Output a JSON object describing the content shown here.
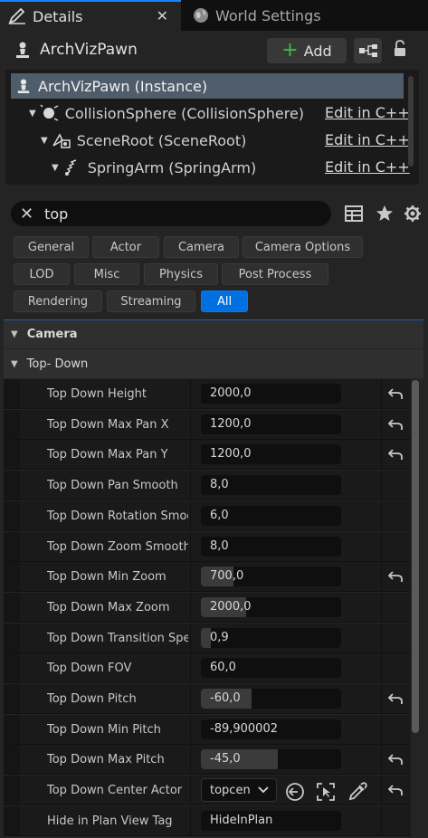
{
  "tabs": [
    {
      "label": "Details",
      "active": true
    },
    {
      "label": "World Settings",
      "active": false
    }
  ],
  "header": {
    "title": "ArchVizPawn",
    "add_label": "Add"
  },
  "tree": [
    {
      "label": "ArchVizPawn (Instance)",
      "edit": ""
    },
    {
      "label": "CollisionSphere (CollisionSphere)",
      "edit": "Edit in C++"
    },
    {
      "label": "SceneRoot (SceneRoot)",
      "edit": "Edit in C++"
    },
    {
      "label": "SpringArm (SpringArm)",
      "edit": "Edit in C++"
    }
  ],
  "search": {
    "value": "top"
  },
  "filters": [
    "General",
    "Actor",
    "Camera",
    "Camera Options",
    "LOD",
    "Misc",
    "Physics",
    "Post Process",
    "Rendering",
    "Streaming",
    "All"
  ],
  "active_filter": "All",
  "categories": [
    "Camera",
    "Top- Down"
  ],
  "properties": [
    {
      "name": "Top Down Height",
      "value": "2000,0",
      "reset": true,
      "fill": 0
    },
    {
      "name": "Top Down Max Pan X",
      "value": "1200,0",
      "reset": true,
      "fill": 0
    },
    {
      "name": "Top Down Max Pan Y",
      "value": "1200,0",
      "reset": true,
      "fill": 0
    },
    {
      "name": "Top Down Pan Smooth",
      "value": "8,0",
      "reset": false,
      "fill": 0
    },
    {
      "name": "Top Down Rotation Smooth",
      "value": "6,0",
      "reset": false,
      "fill": 0
    },
    {
      "name": "Top Down Zoom Smooth",
      "value": "8,0",
      "reset": false,
      "fill": 0
    },
    {
      "name": "Top Down Min Zoom",
      "value": "700,0",
      "reset": true,
      "fill": 0.23
    },
    {
      "name": "Top Down Max Zoom",
      "value": "2000,0",
      "reset": false,
      "fill": 0.32
    },
    {
      "name": "Top Down Transition Spe...",
      "value": "0,9",
      "reset": false,
      "fill": 0.07
    },
    {
      "name": "Top Down FOV",
      "value": "60,0",
      "reset": false,
      "fill": 0
    },
    {
      "name": "Top Down Pitch",
      "value": "-60,0",
      "reset": true,
      "fill": 0.36
    },
    {
      "name": "Top Down Min Pitch",
      "value": "-89,900002",
      "reset": false,
      "fill": 0
    },
    {
      "name": "Top Down Max Pitch",
      "value": "-45,0",
      "reset": true,
      "fill": 0.55
    },
    {
      "name": "Top Down Center Actor",
      "value": "topcen",
      "reset": true,
      "fill": 0,
      "dropdown": true
    },
    {
      "name": "Hide in Plan View Tag",
      "value": "HideInPlan",
      "reset": false,
      "fill": 0
    }
  ],
  "colors": {
    "accent": "#0070e0",
    "add_plus": "#3fb84a",
    "tab_underline": "#1a82ff"
  }
}
